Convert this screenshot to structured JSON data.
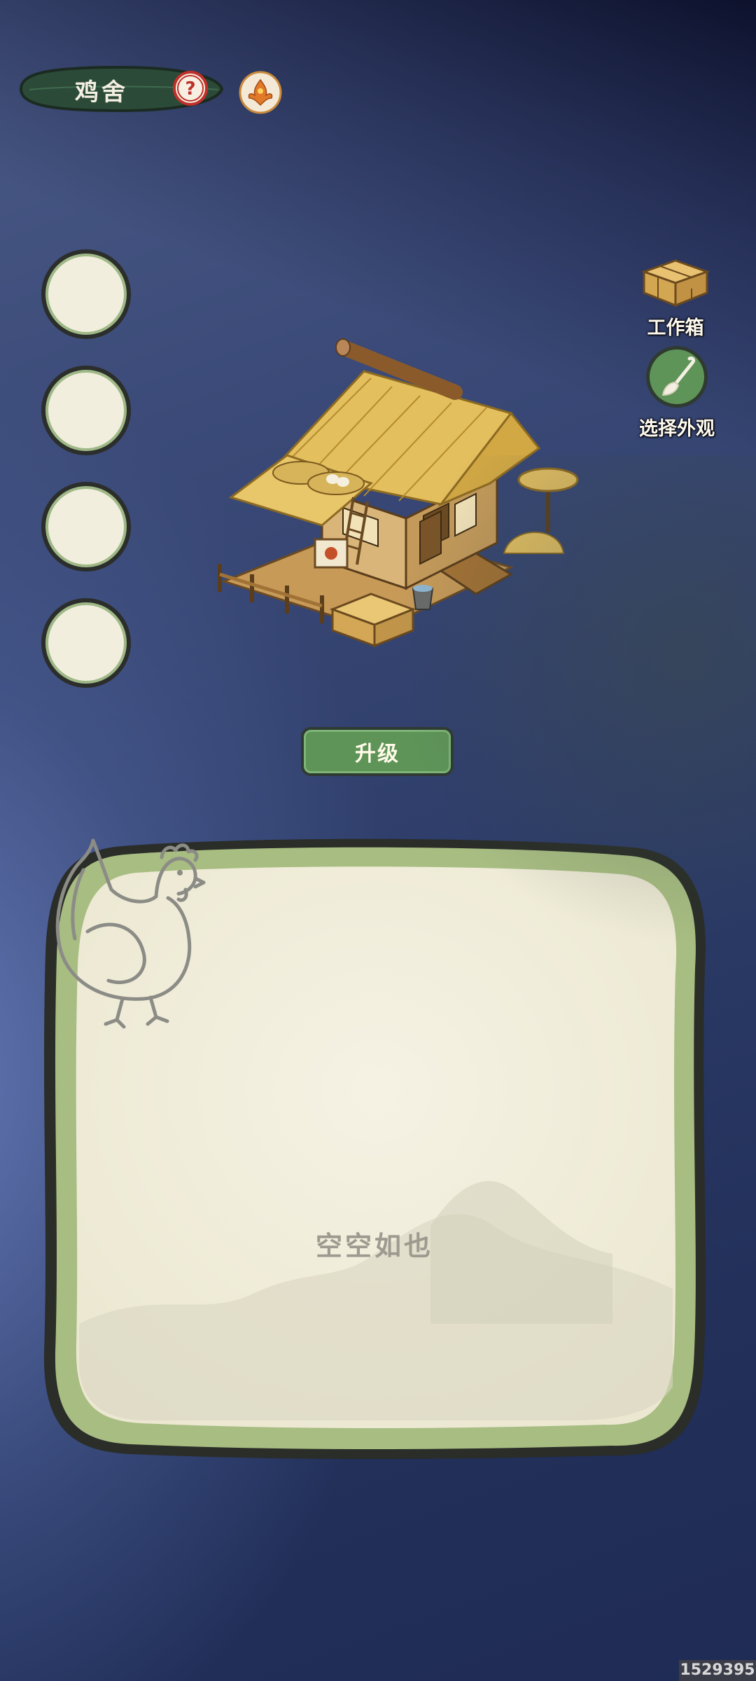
{
  "header": {
    "title": "鸡舍",
    "help_icon": "question-mark-icon",
    "badge_icon": "phoenix-icon"
  },
  "slots": [
    {
      "name": "slot-1"
    },
    {
      "name": "slot-2"
    },
    {
      "name": "slot-3"
    },
    {
      "name": "slot-4"
    }
  ],
  "side_buttons": {
    "workbox_label": "工作箱",
    "appearance_label": "选择外观"
  },
  "upgrade": {
    "label": "升级"
  },
  "panel": {
    "empty_label": "空空如也"
  },
  "watermark": "1529395",
  "colors": {
    "accent_green": "#5e9458",
    "parchment": "#f2efdf",
    "panel_border": "#a8bd82"
  }
}
